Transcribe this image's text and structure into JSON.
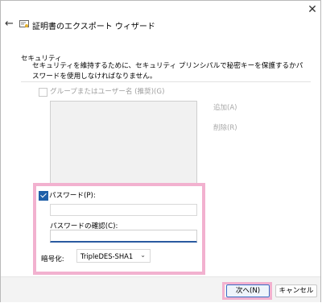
{
  "window": {
    "title": "証明書のエクスポート ウィザード",
    "close_label": "✕",
    "back_label": "←"
  },
  "security": {
    "heading": "セキュリティ",
    "description": "セキュリティを維持するために、セキュリティ プリンシパルで秘密キーを保護するかパスワードを使用しなければなりません。"
  },
  "group": {
    "label": "グループまたはユーザー名 (推奨)(G)",
    "checked": false,
    "add_label": "追加(A)",
    "remove_label": "削除(R)"
  },
  "password": {
    "checkbox_label": "パスワード(P):",
    "checked": true,
    "value": "",
    "confirm_label": "パスワードの確認(C):",
    "confirm_value": ""
  },
  "encryption": {
    "label": "暗号化:",
    "selected": "TripleDES-SHA1"
  },
  "footer": {
    "next_label": "次へ(N)",
    "cancel_label": "キャンセル"
  },
  "colors": {
    "highlight": "#f2b1cf",
    "accent": "#1f5fa8"
  }
}
